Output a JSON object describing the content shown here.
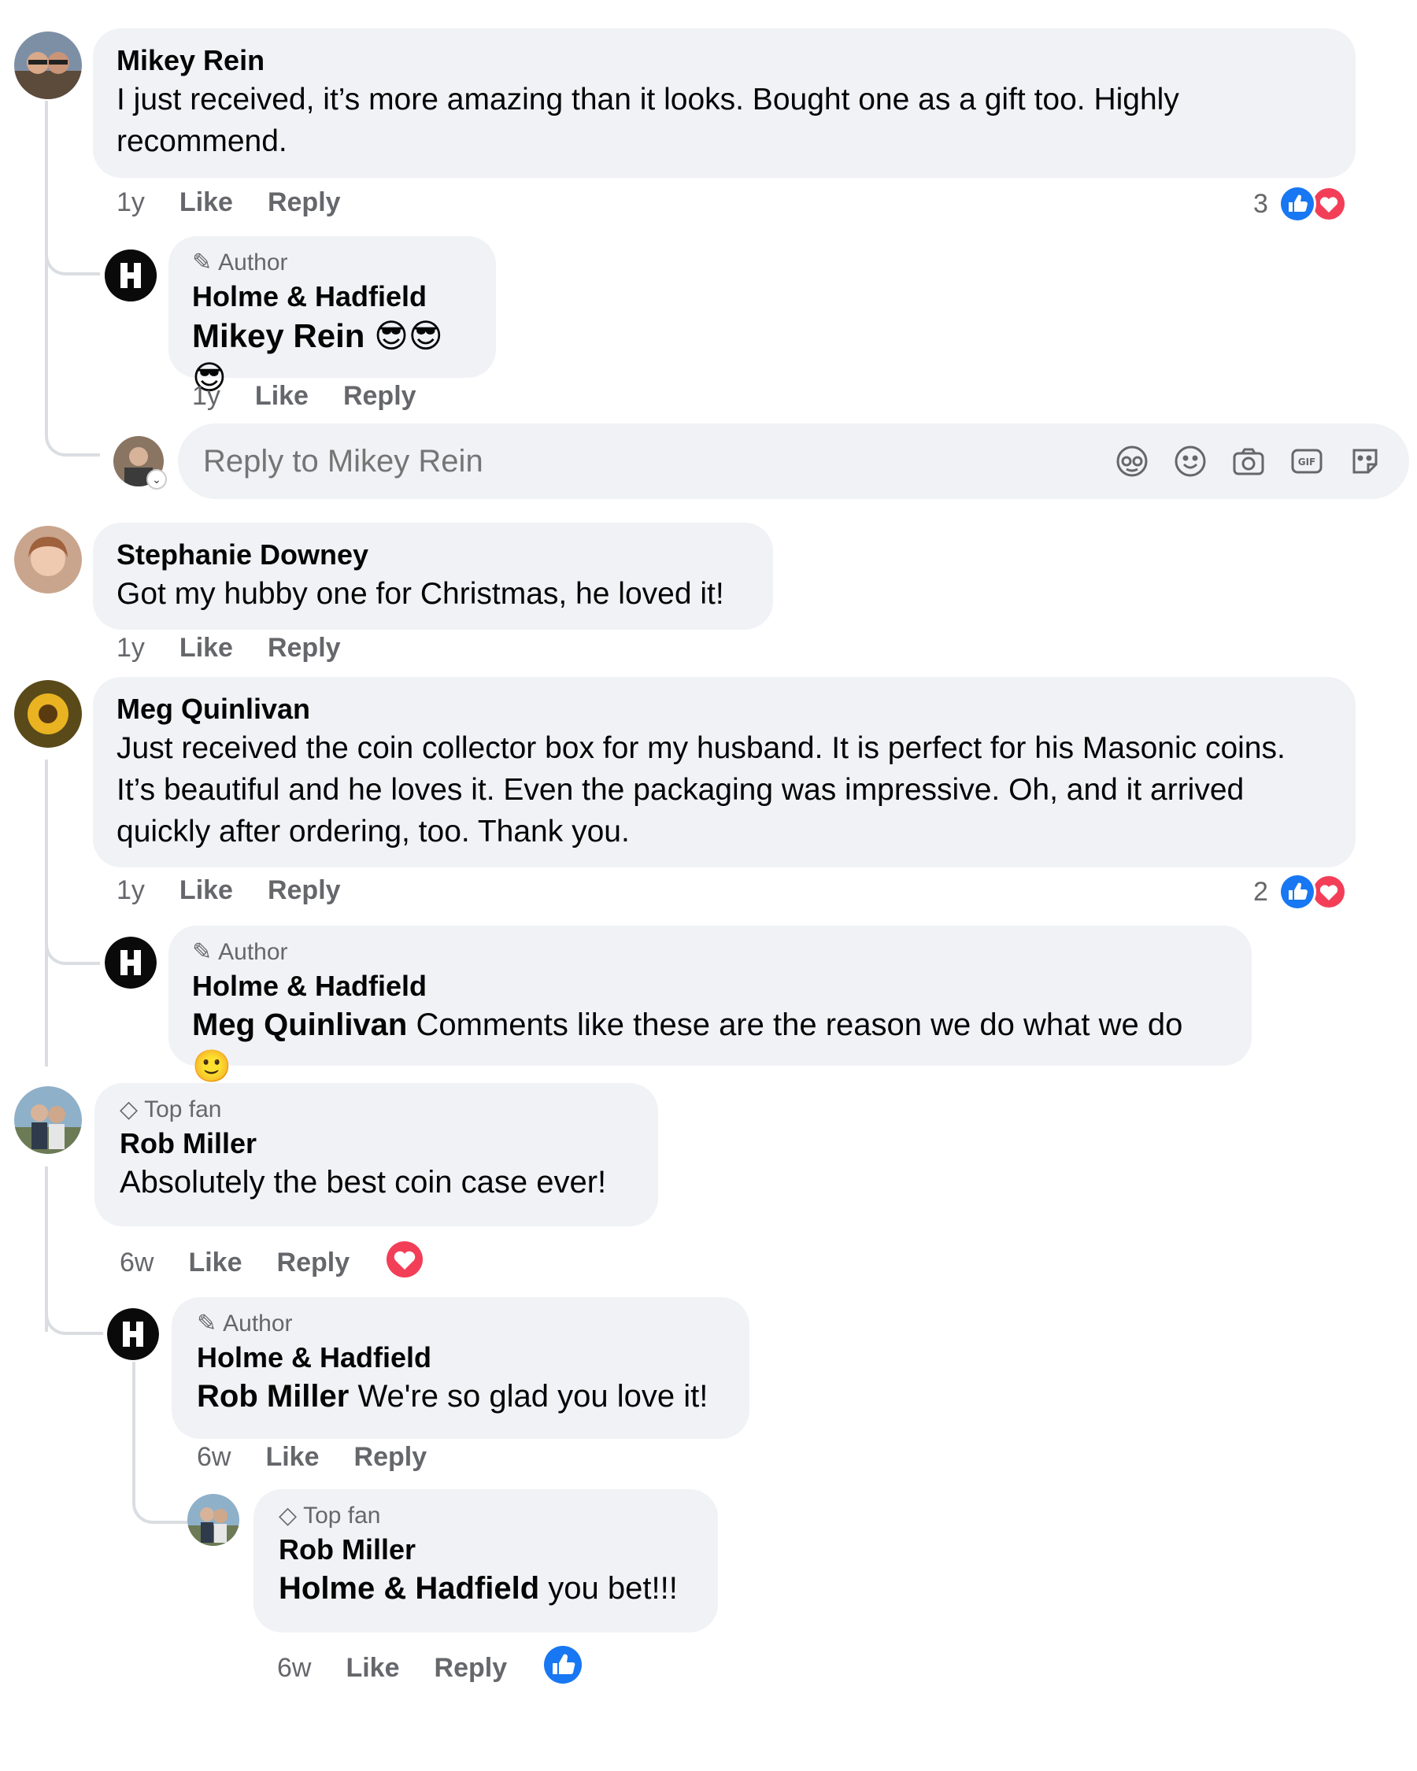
{
  "comments": [
    {
      "author": "Mikey Rein",
      "text": "I just received, it’s more amazing than it looks. Bought one as a gift too. Highly recommend.",
      "time": "1y",
      "like_label": "Like",
      "reply_label": "Reply",
      "reaction_count": "3",
      "reactions": [
        "like",
        "love"
      ],
      "replies": [
        {
          "badge": "Author",
          "author": "Holme & Hadfield",
          "mention": "Mikey Rein",
          "text": " 😎😎😎",
          "time": "1y",
          "like_label": "Like",
          "reply_label": "Reply"
        }
      ],
      "reply_box": {
        "placeholder": "Reply to Mikey Rein"
      }
    },
    {
      "author": "Stephanie Downey",
      "text": "Got my hubby one for Christmas, he loved it!",
      "time": "1y",
      "like_label": "Like",
      "reply_label": "Reply"
    },
    {
      "author": "Meg Quinlivan",
      "text": "Just received the coin collector box for my husband. It is perfect for his Masonic coins. It’s beautiful and he loves it. Even the packaging was impressive. Oh, and it arrived quickly after ordering, too. Thank you.",
      "time": "1y",
      "like_label": "Like",
      "reply_label": "Reply",
      "reaction_count": "2",
      "reactions": [
        "like",
        "love"
      ],
      "replies": [
        {
          "badge": "Author",
          "author": "Holme & Hadfield",
          "mention": "Meg Quinlivan",
          "text": " Comments like these are the reason we do what we do 🙂"
        }
      ]
    },
    {
      "badge": "Top fan",
      "author": "Rob Miller",
      "text": "Absolutely the best coin case ever!",
      "time": "6w",
      "like_label": "Like",
      "reply_label": "Reply",
      "reactions": [
        "love"
      ],
      "replies": [
        {
          "badge": "Author",
          "author": "Holme & Hadfield",
          "mention": "Rob Miller",
          "text": " We're so glad you love it!",
          "time": "6w",
          "like_label": "Like",
          "reply_label": "Reply",
          "replies": [
            {
              "badge": "Top fan",
              "author": "Rob Miller",
              "mention": "Holme & Hadfield",
              "text": " you bet!!!",
              "time": "6w",
              "like_label": "Like",
              "reply_label": "Reply",
              "reactions": [
                "like"
              ]
            }
          ]
        }
      ]
    }
  ],
  "composer_icons": [
    "avatar-sticker-icon",
    "emoji-icon",
    "camera-icon",
    "gif-icon",
    "sticker-icon"
  ],
  "colors": {
    "bubble": "#f0f2f5",
    "muted": "#65676b",
    "like_blue": "#1877f2",
    "love_red": "#f33e58"
  }
}
